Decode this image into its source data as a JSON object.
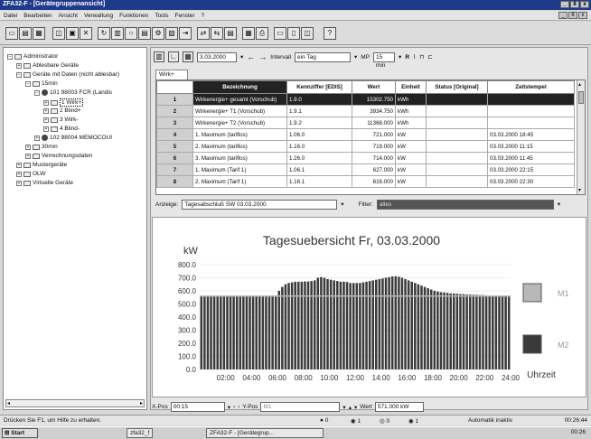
{
  "window": {
    "title": "ZFA32-F - [Gerätegruppenansicht]",
    "controls": [
      "_",
      "8",
      "x"
    ]
  },
  "menu": [
    "Datei",
    "Bearbeiten",
    "Ansicht",
    "Verwaltung",
    "Funktionen",
    "Tools",
    "Fenster",
    "?"
  ],
  "tree": {
    "items": [
      {
        "label": "Administrator",
        "level": 0
      },
      {
        "label": "Ablesbare Geräte",
        "level": 1
      },
      {
        "label": "Geräte mit Daten (nicht ablesbar)",
        "level": 1
      },
      {
        "label": "15min",
        "level": 2
      },
      {
        "label": "101  98003  FCR (Landis",
        "level": 3
      },
      {
        "label": "1 Wirk+",
        "level": 4
      },
      {
        "label": "2 Blind+",
        "level": 4
      },
      {
        "label": "3 Wirk-",
        "level": 4
      },
      {
        "label": "4 Blind-",
        "level": 4
      },
      {
        "label": "102  98004  MEMOCOUI",
        "level": 3
      },
      {
        "label": "30min",
        "level": 2
      },
      {
        "label": "Verrechnungsdaten",
        "level": 2
      },
      {
        "label": "Mustergeräte",
        "level": 1
      },
      {
        "label": "OLW",
        "level": 1
      },
      {
        "label": "Virtuelle Geräte",
        "level": 1
      }
    ]
  },
  "subbar": {
    "date": "3.03.2000",
    "interval_label": "Intervall",
    "interval_value": "ein Tag",
    "mp_label": "MP",
    "mp_value": "15 min",
    "r_label": "R"
  },
  "tab": {
    "label": "Wirk+"
  },
  "table": {
    "headers": [
      "",
      "Bezeichnung",
      "Kennziffer [EDIS]",
      "Wert",
      "Einheit",
      "Status [Original]",
      "Zeitstempel"
    ],
    "rows": [
      {
        "n": "1",
        "name": "Wirkenergie+ gesamt (Vorschub)",
        "code": "1.9.0",
        "value": "15302.750",
        "unit": "kWh",
        "status": "",
        "time": ""
      },
      {
        "n": "2",
        "name": "Wirkenergie+ T1 (Vorschub)",
        "code": "1.9.1",
        "value": "3934.750",
        "unit": "kWh",
        "status": "",
        "time": ""
      },
      {
        "n": "3",
        "name": "Wirkenergie+ T2 (Vorschub)",
        "code": "1.9.2",
        "value": "11368.000",
        "unit": "kWh",
        "status": "",
        "time": ""
      },
      {
        "n": "4",
        "name": "1. Maximum (tariflos)",
        "code": "1.06.0",
        "value": "721.000",
        "unit": "kW",
        "status": "",
        "time": "03.03.2000 18:45"
      },
      {
        "n": "5",
        "name": "2. Maximum (tariflos)",
        "code": "1.16.0",
        "value": "719.000",
        "unit": "kW",
        "status": "",
        "time": "03.03.2000 11:15"
      },
      {
        "n": "6",
        "name": "3. Maximum (tariflos)",
        "code": "1.26.0",
        "value": "714.000",
        "unit": "kW",
        "status": "",
        "time": "03.03.2000 11:45"
      },
      {
        "n": "7",
        "name": "1. Maximum (Tarif 1)",
        "code": "1.06.1",
        "value": "627.000",
        "unit": "kW",
        "status": "",
        "time": "03.03.2000 22:15"
      },
      {
        "n": "8",
        "name": "2. Maximum (Tarif 1)",
        "code": "1.16.1",
        "value": "616.000",
        "unit": "kW",
        "status": "",
        "time": "03.03.2000 22:30"
      }
    ]
  },
  "filterrow": {
    "anzeige_label": "Anzeige:",
    "anzeige_value": "Tagesabschluß    SW  03.03.2000",
    "filter_label": "Filter:",
    "filter_value": "alles"
  },
  "chart_data": {
    "type": "bar",
    "title": "Tagesuebersicht  Fr, 03.03.2000",
    "ylabel": "kW",
    "xlabel": "Uhrzeit",
    "ylim": [
      0,
      800
    ],
    "yticks": [
      "0.0",
      "100.0",
      "200.0",
      "300.0",
      "400.0",
      "500.0",
      "600.0",
      "700.0",
      "800.0"
    ],
    "xticks": [
      "02:00",
      "04:00",
      "06:00",
      "08:00",
      "10:00",
      "12:00",
      "14:00",
      "16:00",
      "18:00",
      "20:00",
      "22:00",
      "24:00"
    ],
    "series": [
      {
        "name": "M1",
        "type": "step",
        "color": "#b8b8b8",
        "values": [
          560,
          560,
          560,
          560,
          560,
          560,
          560,
          560,
          560,
          560,
          560,
          560,
          560,
          560,
          560,
          560,
          560,
          560,
          560,
          560,
          560,
          560,
          560,
          560,
          560,
          560,
          560,
          560,
          560,
          560,
          560,
          560,
          560,
          560,
          560,
          560,
          560,
          560,
          560,
          560,
          560,
          560,
          560,
          560,
          560,
          560,
          560,
          560,
          560,
          560,
          560,
          560,
          560,
          560,
          560,
          560,
          560,
          560,
          560,
          560,
          560,
          560,
          560,
          560,
          560,
          560,
          560,
          560,
          560,
          560,
          560,
          560,
          560,
          560,
          560,
          560,
          560,
          560,
          560,
          560,
          560,
          560,
          560,
          560,
          560,
          560,
          560,
          560,
          560,
          560,
          560,
          560,
          560,
          560,
          560,
          560
        ]
      },
      {
        "name": "M2",
        "color": "#3a3a3a",
        "values": [
          555,
          555,
          555,
          555,
          555,
          555,
          555,
          555,
          555,
          555,
          555,
          555,
          555,
          555,
          555,
          555,
          555,
          555,
          555,
          555,
          555,
          555,
          555,
          555,
          600,
          630,
          650,
          660,
          665,
          670,
          670,
          670,
          672,
          672,
          675,
          680,
          700,
          705,
          700,
          690,
          685,
          680,
          675,
          670,
          670,
          668,
          660,
          660,
          660,
          660,
          665,
          670,
          675,
          680,
          685,
          690,
          695,
          700,
          705,
          710,
          712,
          708,
          700,
          690,
          680,
          670,
          660,
          650,
          640,
          630,
          620,
          610,
          600,
          595,
          590,
          588,
          585,
          580,
          580,
          578,
          575,
          575,
          572,
          572,
          570,
          570,
          568,
          568,
          565,
          565,
          565,
          565,
          560,
          560,
          560,
          560
        ]
      }
    ],
    "legend": [
      "M1",
      "M2"
    ],
    "legend_placement": "right"
  },
  "bottombar": {
    "xpos_label": "X-Pos",
    "xpos_value": "00:15",
    "ypos_label": "Y-Pos",
    "ypos_value": "M1",
    "wert_label": "Wert",
    "wert_value": "571.000 kW"
  },
  "statusbar": {
    "help": "Drücken Sie F1, um Hilfe zu erhalten.",
    "counters": [
      "0",
      "1",
      "0",
      "1"
    ],
    "auto": "Automatik inaktiv",
    "time": "00:26:44"
  },
  "taskbar": {
    "start": "Start",
    "task1": "zfa32_f",
    "task2": "ZFA32-F - [Gerätegrup...",
    "clock": "00:26"
  }
}
